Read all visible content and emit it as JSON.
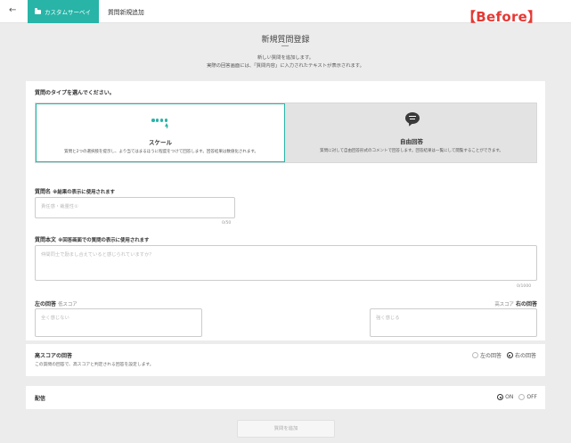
{
  "header": {
    "back_icon": "arrow-left-icon",
    "brand_tab": "カスタムサーベイ",
    "crumb_title": "質問新規追加",
    "before_label": "【Before】",
    "brand_color": "#28b4a7",
    "label_color": "#e53935"
  },
  "intro": {
    "title": "新規質問登録",
    "dash": "—",
    "desc1": "新しい質問を追加します。",
    "desc2": "実際の回答画面には、「質問内容」に入力されたテキストが表示されます。"
  },
  "type_section": {
    "label": "質問のタイプを選んでください。",
    "options": [
      {
        "icon": "scale-dots-icon",
        "title": "スケール",
        "description": "質問と2つの選択肢を提示し、より当てはまるほうに程度をつけて回答します。回答結果は数値化されます。",
        "selected": true
      },
      {
        "icon": "chat-bubble-icon",
        "title": "自由回答",
        "description": "質問に対して自由回答形式のコメントで回答します。回答結果は一覧にして閲覧することができます。",
        "selected": false
      }
    ]
  },
  "question_name": {
    "label": "質問名",
    "note": "※結果の表示に使用されます",
    "placeholder": "責任感・裁量性①",
    "counter": "0/50"
  },
  "question_body": {
    "label": "質問本文",
    "note": "※回答画面での質問の表示に使用されます",
    "placeholder": "仲間同士で励まし合えていると感じられていますか？",
    "counter": "0/1000"
  },
  "answers": {
    "left_label": "左の回答",
    "left_score": "低スコア",
    "left_placeholder": "全く感じない",
    "right_score": "高スコア",
    "right_label": "右の回答",
    "right_placeholder": "強く感じる"
  },
  "high_score": {
    "title": "高スコアの回答",
    "description": "この質問の回答で、高スコアと判定される回答を設定します。",
    "options": [
      {
        "label": "左の回答",
        "selected": false
      },
      {
        "label": "右の回答",
        "selected": true
      }
    ]
  },
  "publish": {
    "label": "配信",
    "options": [
      {
        "label": "ON",
        "selected": true
      },
      {
        "label": "OFF",
        "selected": false
      }
    ]
  },
  "submit_label": "質問を追加"
}
